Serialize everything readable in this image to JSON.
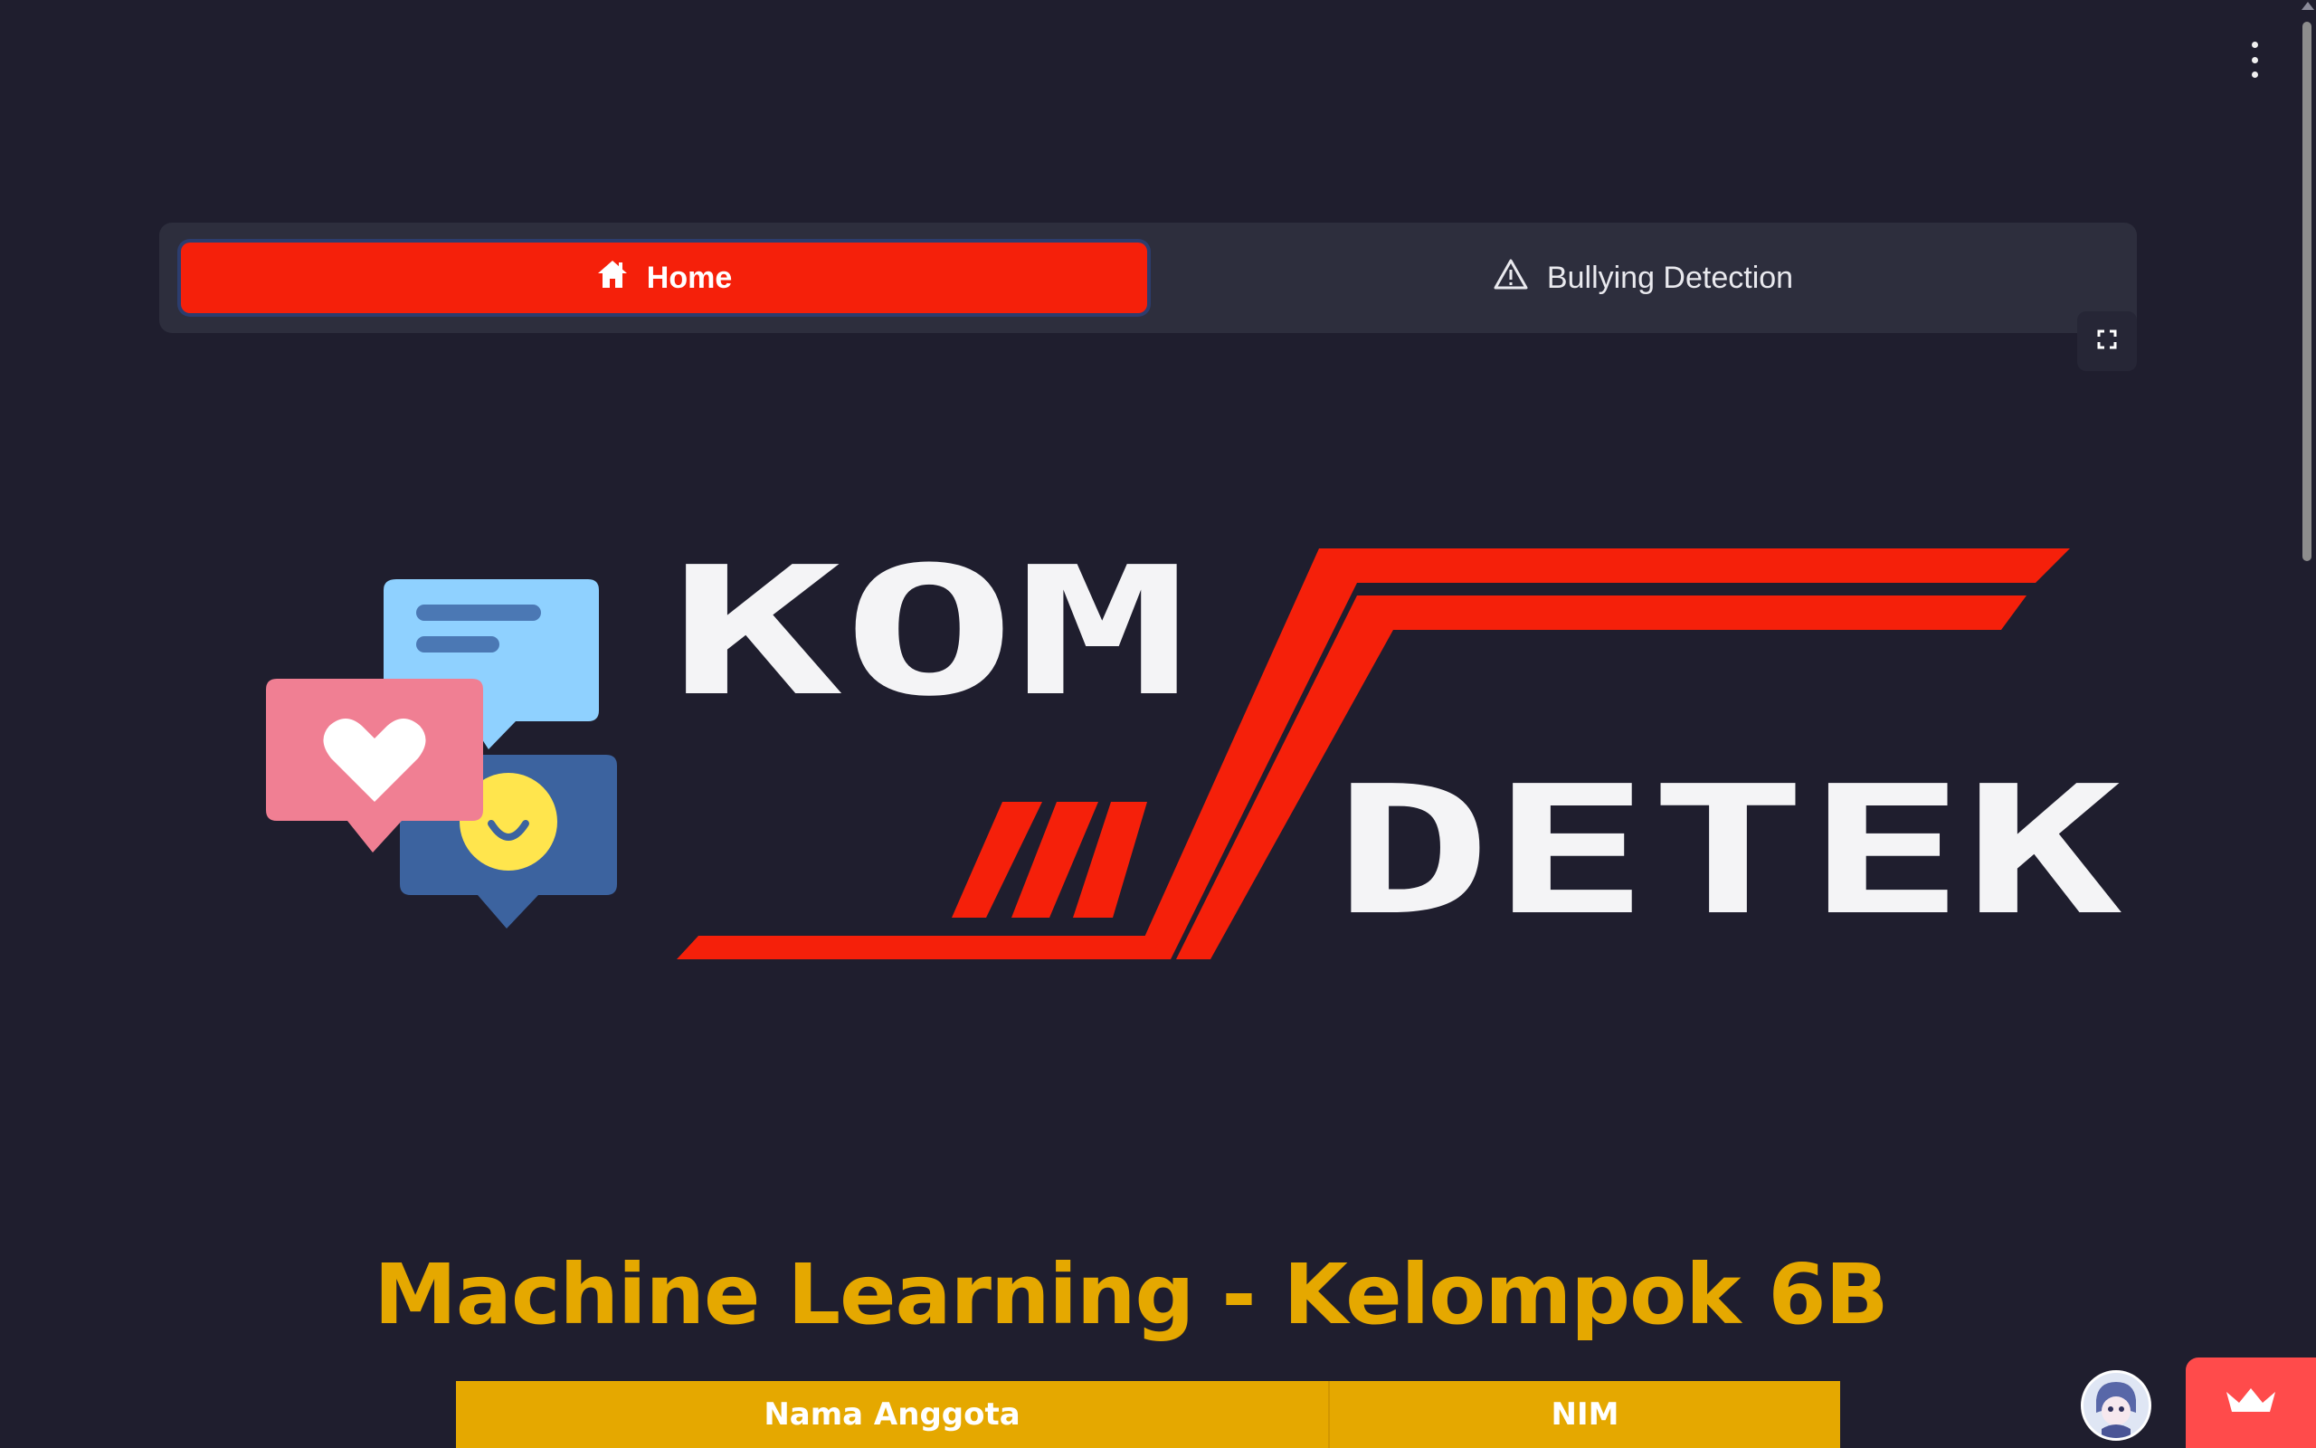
{
  "nav": {
    "tabs": [
      {
        "label": "Home",
        "icon": "home-icon",
        "active": true
      },
      {
        "label": "Bullying Detection",
        "icon": "warning-icon",
        "active": false
      }
    ],
    "active_color": "#f5200a"
  },
  "logo": {
    "text_line1": "KOM",
    "text_line2": "DETEK",
    "accent_color": "#f5200a"
  },
  "main": {
    "title": "Machine Learning - Kelompok 6B",
    "title_color": "#e5a800",
    "table": {
      "headers": [
        "Nama Anggota",
        "NIM"
      ]
    }
  }
}
